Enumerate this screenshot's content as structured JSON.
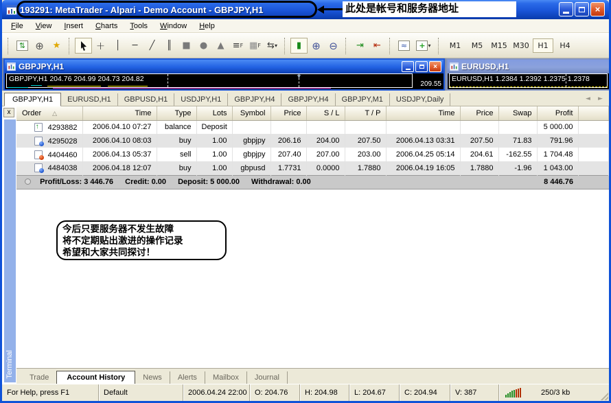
{
  "window": {
    "title": "193291: MetaTrader - Alpari - Demo Account - GBPJPY,H1",
    "annotation": "此处是帐号和服务器地址"
  },
  "menubar": {
    "items": [
      "File",
      "View",
      "Insert",
      "Charts",
      "Tools",
      "Window",
      "Help"
    ]
  },
  "toolbar": {
    "timeframes": [
      "M1",
      "M5",
      "M15",
      "M30",
      "H1",
      "H4"
    ],
    "active_timeframe": "H1"
  },
  "charts": {
    "gbpjpy": {
      "title": "GBPJPY,H1",
      "quote_line": "GBPJPY,H1  204.76 204.99 204.73 204.82",
      "price_label": "209.55"
    },
    "eurusd": {
      "title": "EURUSD,H1",
      "quote_line": "EURUSD,H1  1.2384 1.2392 1.2375 1.2378"
    }
  },
  "chart_tabs": {
    "active": "GBPJPY,H1",
    "items": [
      "GBPJPY,H1",
      "EURUSD,H1",
      "GBPUSD,H1",
      "USDJPY,H1",
      "GBPJPY,H4",
      "GBPJPY,H4",
      "GBPJPY,M1",
      "USDJPY,Daily"
    ]
  },
  "terminal": {
    "side_label": "Terminal",
    "close_label": "x",
    "columns": [
      "Order",
      "Time",
      "Type",
      "Lots",
      "Symbol",
      "Price",
      "S / L",
      "T / P",
      "Time",
      "Price",
      "Swap",
      "Profit"
    ],
    "rows": [
      {
        "icon": "deposit",
        "order": "4293882",
        "open_time": "2006.04.10 07:27",
        "type": "balance",
        "lots": "Deposit",
        "symbol": "",
        "price": "",
        "sl": "",
        "tp": "",
        "close_time": "",
        "close_price": "",
        "swap": "",
        "profit": "5 000.00"
      },
      {
        "icon": "buy",
        "order": "4295028",
        "open_time": "2006.04.10 08:03",
        "type": "buy",
        "lots": "1.00",
        "symbol": "gbpjpy",
        "price": "206.16",
        "sl": "204.00",
        "tp": "207.50",
        "close_time": "2006.04.13 03:31",
        "close_price": "207.50",
        "swap": "71.83",
        "profit": "791.96"
      },
      {
        "icon": "sell",
        "order": "4404460",
        "open_time": "2006.04.13 05:37",
        "type": "sell",
        "lots": "1.00",
        "symbol": "gbpjpy",
        "price": "207.40",
        "sl": "207.00",
        "tp": "203.00",
        "close_time": "2006.04.25 05:14",
        "close_price": "204.61",
        "swap": "-162.55",
        "profit": "1 704.48"
      },
      {
        "icon": "buy",
        "order": "4484038",
        "open_time": "2006.04.18 12:07",
        "type": "buy",
        "lots": "1.00",
        "symbol": "gbpusd",
        "price": "1.7731",
        "sl": "0.0000",
        "tp": "1.7880",
        "close_time": "2006.04.19 16:05",
        "close_price": "1.7880",
        "swap": "-1.96",
        "profit": "1 043.00"
      }
    ],
    "summary": {
      "profit_loss": "Profit/Loss: 3 446.76",
      "credit": "Credit: 0.00",
      "deposit": "Deposit: 5 000.00",
      "withdrawal": "Withdrawal: 0.00",
      "total": "8 446.76"
    },
    "note_lines": [
      "今后只要服务器不发生故障",
      "将不定期贴出激进的操作记录",
      "希望和大家共同探讨！"
    ],
    "tabs": {
      "active": "Account History",
      "items": [
        "Trade",
        "Account History",
        "News",
        "Alerts",
        "Mailbox",
        "Journal"
      ]
    }
  },
  "statusbar": {
    "help": "For Help, press F1",
    "profile": "Default",
    "time": "2006.04.24 22:00",
    "open": "O: 204.76",
    "high": "H: 204.98",
    "low": "L: 204.67",
    "close": "C: 204.94",
    "volume": "V: 387",
    "traffic": "250/3 kb"
  },
  "colors": {
    "titlebar_blue": "#1a55d8",
    "inactive_titlebar": "#8ba2dc",
    "tp_highlight_green": "#54d254",
    "chart_bg": "#000000",
    "panel_beige": "#ece9d8",
    "terminal_strip_blue": "#93b1ea"
  }
}
